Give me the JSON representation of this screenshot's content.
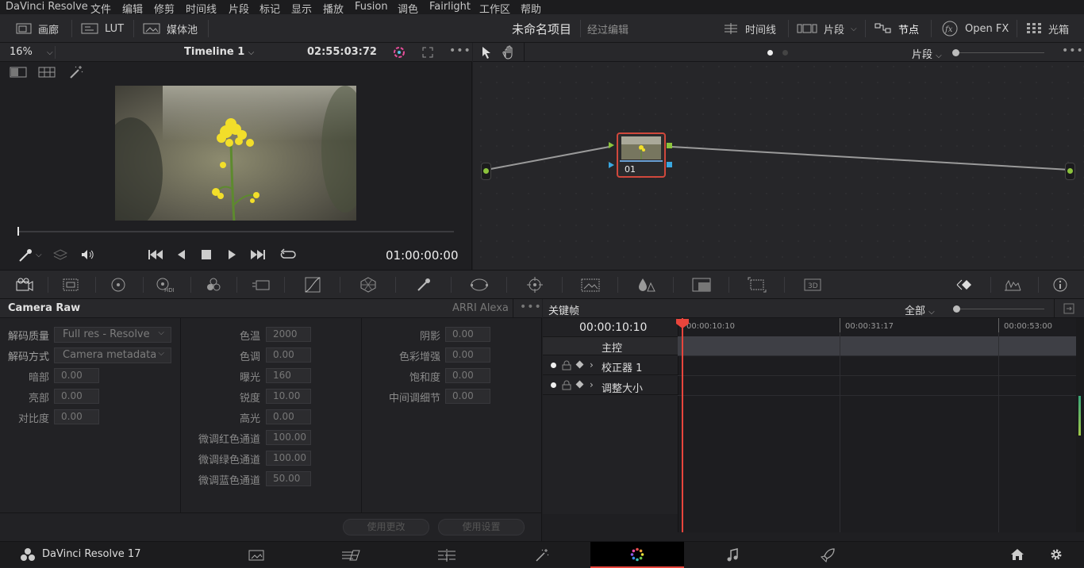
{
  "menu": [
    "DaVinci Resolve",
    "文件",
    "编辑",
    "修剪",
    "时间线",
    "片段",
    "标记",
    "显示",
    "播放",
    "Fusion",
    "调色",
    "Fairlight",
    "工作区",
    "帮助"
  ],
  "toolbar": {
    "gallery": "画廊",
    "lut": "LUT",
    "media_pool": "媒体池",
    "project": "未命名项目",
    "edited": "经过编辑",
    "timeline": "时间线",
    "clips": "片段",
    "nodes": "节点",
    "openfx": "Open FX",
    "lightbox": "光箱"
  },
  "viewer": {
    "zoom": "16%",
    "timeline_name": "Timeline 1",
    "timecode": "02:55:03:72",
    "playhead_tc": "01:00:00:00"
  },
  "nodegraph": {
    "mode": "片段",
    "node_label": "01"
  },
  "camera_raw": {
    "title": "Camera Raw",
    "camera": "ARRI Alexa",
    "decode_quality_label": "解码质量",
    "decode_quality_value": "Full res - Resolve",
    "decode_using_label": "解码方式",
    "decode_using_value": "Camera metadata",
    "shadows_label": "暗部",
    "shadows": "0.00",
    "highlights_label": "亮部",
    "highlights": "0.00",
    "contrast_label": "对比度",
    "contrast": "0.00",
    "mid": [
      {
        "label": "色温",
        "value": "2000"
      },
      {
        "label": "色调",
        "value": "0.00"
      },
      {
        "label": "曝光",
        "value": "160"
      },
      {
        "label": "锐度",
        "value": "10.00"
      },
      {
        "label": "高光",
        "value": "0.00"
      },
      {
        "label": "微调红色通道",
        "value": "100.00"
      },
      {
        "label": "微调绿色通道",
        "value": "100.00"
      },
      {
        "label": "微调蓝色通道",
        "value": "50.00"
      }
    ],
    "right": [
      {
        "label": "阴影",
        "value": "0.00"
      },
      {
        "label": "色彩增强",
        "value": "0.00"
      },
      {
        "label": "饱和度",
        "value": "0.00"
      },
      {
        "label": "中间调细节",
        "value": "0.00"
      }
    ],
    "apply_changes": "使用更改",
    "apply_settings": "使用设置"
  },
  "keyframes": {
    "title": "关键帧",
    "filter": "全部",
    "current_tc": "00:00:10:10",
    "ruler": [
      "00:00:10:10",
      "00:00:31:17",
      "00:00:53:00"
    ],
    "master": "主控",
    "tracks": [
      "校正器 1",
      "调整大小"
    ]
  },
  "app_name": "DaVinci Resolve 17",
  "colors": {
    "accent": "#e8453c",
    "node_green": "#8cc43c",
    "node_blue": "#3aa7e0"
  }
}
